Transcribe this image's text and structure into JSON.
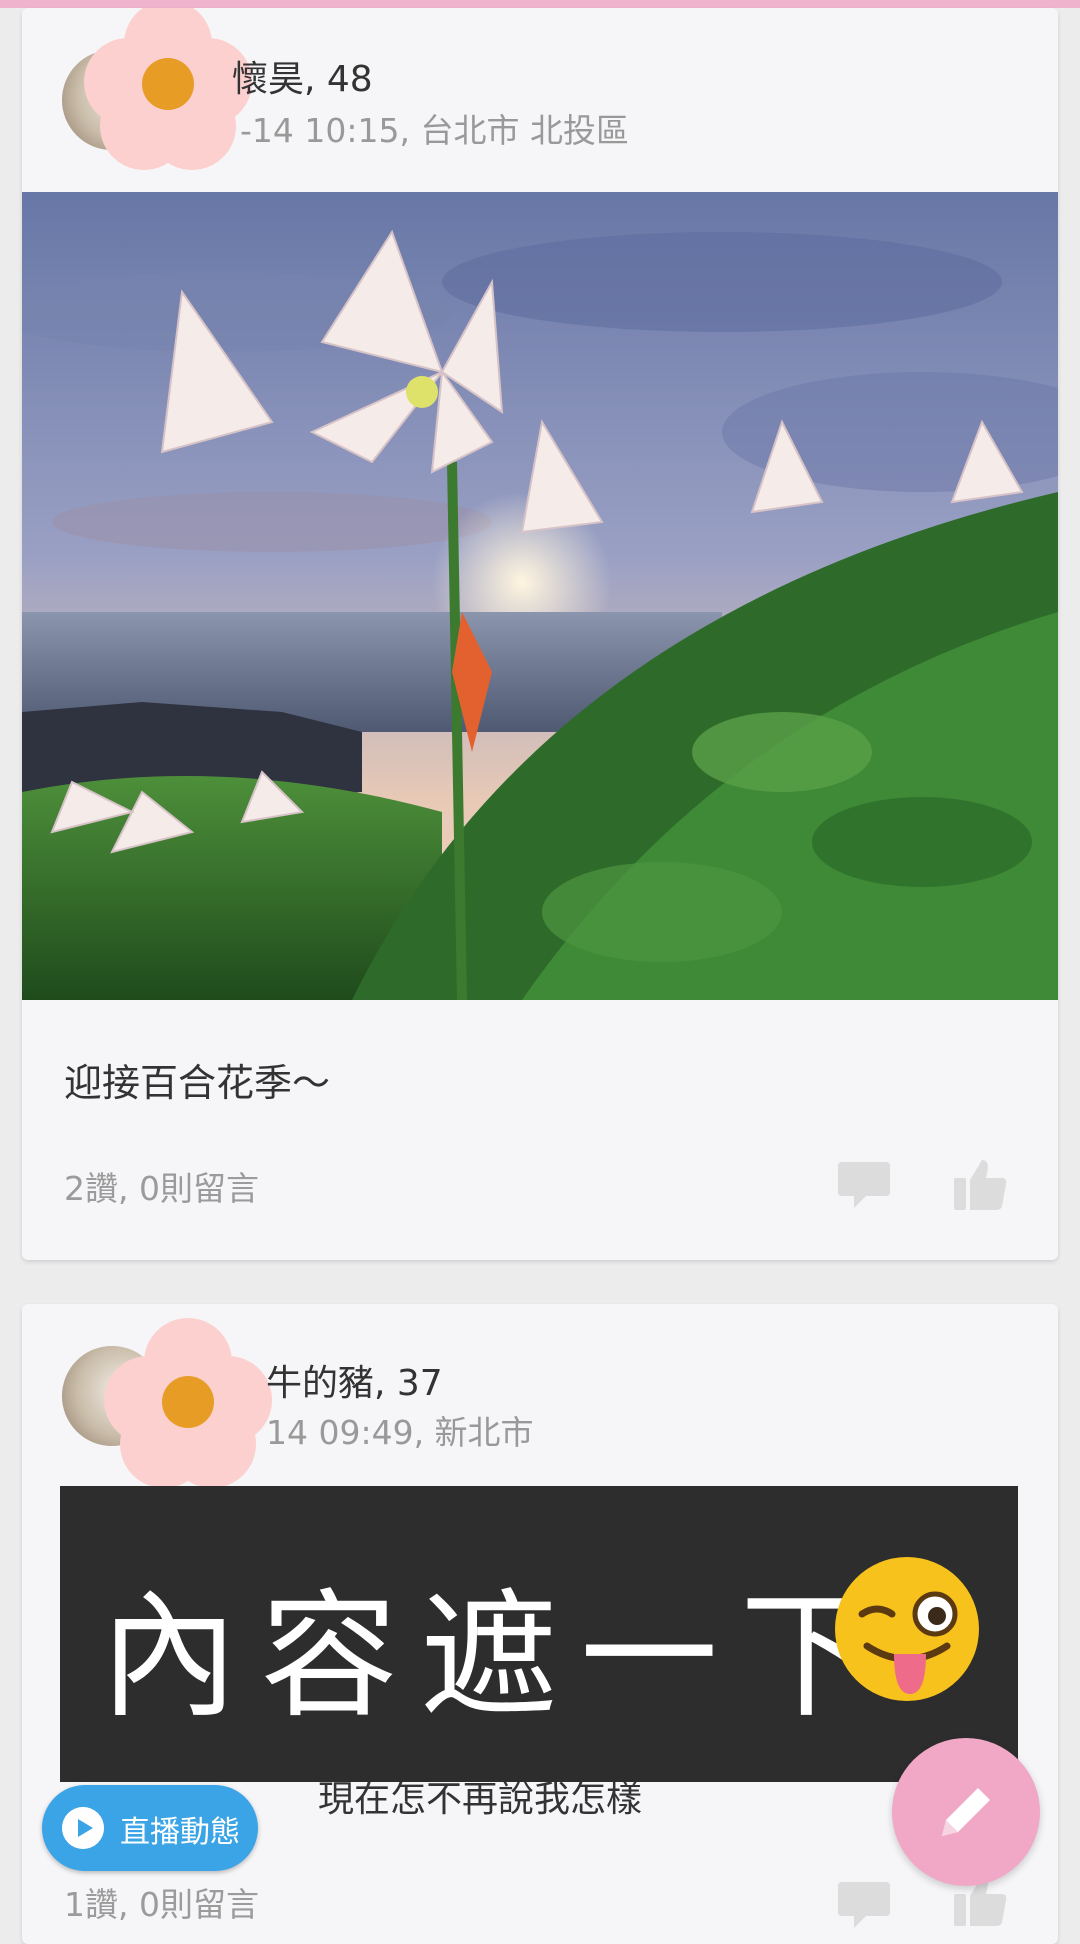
{
  "colors": {
    "top_accent": "#f0b3cd",
    "card_bg": "#f6f6f8",
    "muted_text": "#999999",
    "live_button": "#3aa4e6",
    "fab": "#f0a8c6",
    "mask": "#2d2d2d"
  },
  "posts": [
    {
      "author": "懷昊, 48",
      "meta": "-14 10:15, 台北市 北投區",
      "text": "迎接百合花季～",
      "stats": "2讚, 0則留言",
      "image_icon": "lily-photo"
    },
    {
      "author": "牛的豬, 37",
      "meta": "14 09:49, 新北市",
      "partial_text": "現在怎不再說我怎樣",
      "stats": "1讚, 0則留言"
    }
  ],
  "overlay": {
    "text": "內容遮一下"
  },
  "live_button": {
    "label": "直播動態",
    "icon": "play-circle-icon"
  },
  "fab": {
    "icon": "pencil-icon"
  }
}
